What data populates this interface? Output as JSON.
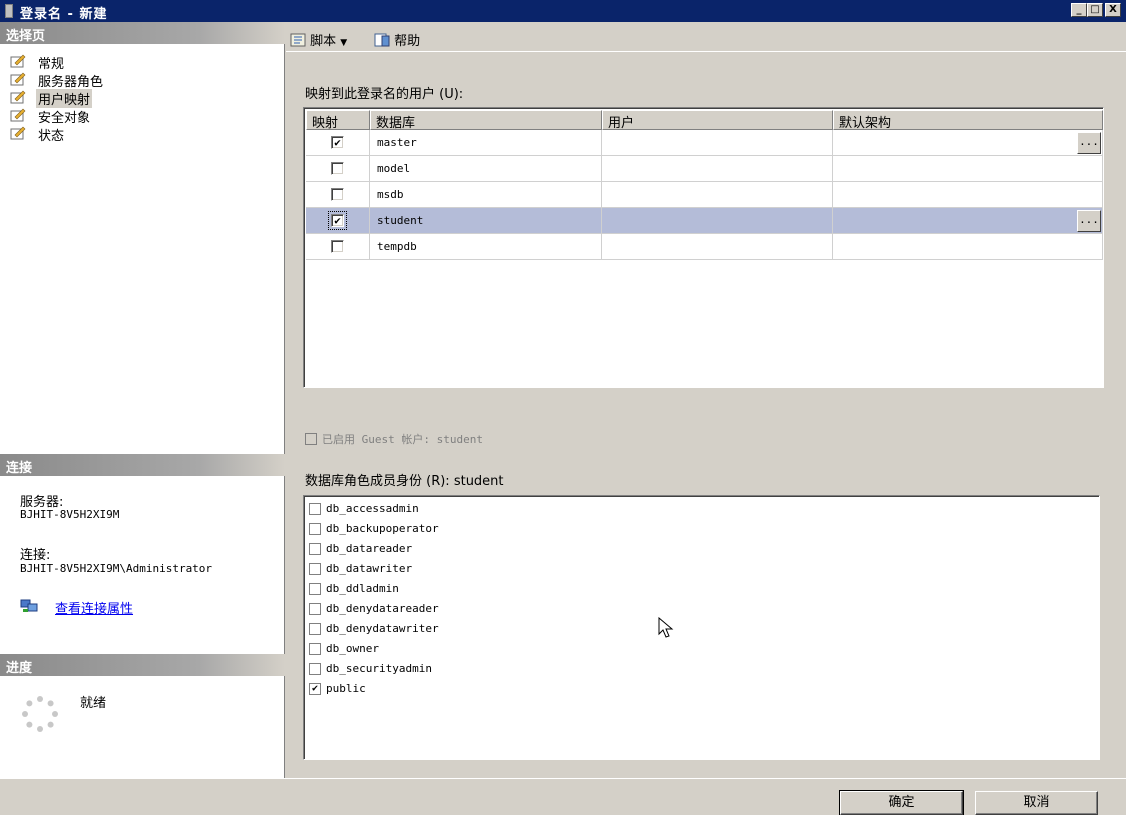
{
  "window": {
    "title": "登录名 - 新建"
  },
  "titlebar_buttons": {
    "minimize": "_",
    "maximize": "□",
    "close": "X"
  },
  "left": {
    "select_page_header": "选择页",
    "nav": [
      {
        "label": "常规",
        "selected": false
      },
      {
        "label": "服务器角色",
        "selected": false
      },
      {
        "label": "用户映射",
        "selected": true
      },
      {
        "label": "安全对象",
        "selected": false
      },
      {
        "label": "状态",
        "selected": false
      }
    ],
    "connection_header": "连接",
    "server_label": "服务器:",
    "server_value": "BJHIT-8V5H2XI9M",
    "connection_label": "连接:",
    "connection_value": "BJHIT-8V5H2XI9M\\Administrator",
    "view_link": "查看连接属性",
    "progress_header": "进度",
    "progress_status": "就绪"
  },
  "toolbar": {
    "script_label": "脚本",
    "help_label": "帮助"
  },
  "mapping": {
    "label": "映射到此登录名的用户 (U):",
    "columns": [
      "映射",
      "数据库",
      "用户",
      "默认架构"
    ],
    "rows": [
      {
        "mapped": true,
        "database": "master",
        "user": "",
        "schema": "",
        "ellipsis": true,
        "selected": false
      },
      {
        "mapped": false,
        "database": "model",
        "user": "",
        "schema": "",
        "ellipsis": false,
        "selected": false
      },
      {
        "mapped": false,
        "database": "msdb",
        "user": "",
        "schema": "",
        "ellipsis": false,
        "selected": false
      },
      {
        "mapped": true,
        "database": "student",
        "user": "",
        "schema": "",
        "ellipsis": true,
        "selected": true
      },
      {
        "mapped": false,
        "database": "tempdb",
        "user": "",
        "schema": "",
        "ellipsis": false,
        "selected": false
      }
    ],
    "ellipsis_label": "..."
  },
  "guest": {
    "label": "已启用 Guest 帐户: student"
  },
  "roles": {
    "label": "数据库角色成员身份 (R): student",
    "items": [
      {
        "name": "db_accessadmin",
        "checked": false
      },
      {
        "name": "db_backupoperator",
        "checked": false
      },
      {
        "name": "db_datareader",
        "checked": false
      },
      {
        "name": "db_datawriter",
        "checked": false
      },
      {
        "name": "db_ddladmin",
        "checked": false
      },
      {
        "name": "db_denydatareader",
        "checked": false
      },
      {
        "name": "db_denydatawriter",
        "checked": false
      },
      {
        "name": "db_owner",
        "checked": false
      },
      {
        "name": "db_securityadmin",
        "checked": false
      },
      {
        "name": "public",
        "checked": true
      }
    ]
  },
  "buttons": {
    "ok": "确定",
    "cancel": "取消"
  },
  "check_mark": "✔"
}
